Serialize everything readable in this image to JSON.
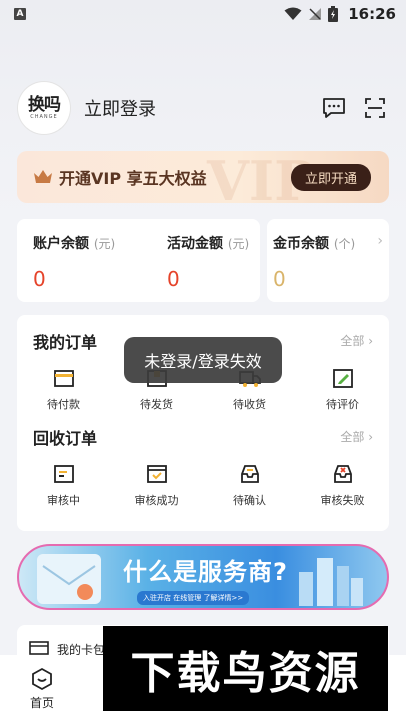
{
  "status_bar": {
    "time": "16:26",
    "notification_letter": "A"
  },
  "header": {
    "logo_text": "换吗",
    "logo_subtext": "CHANGE",
    "login_label": "立即登录"
  },
  "vip_banner": {
    "text": "开通VIP 享五大权益",
    "button_label": "立即开通"
  },
  "balance": {
    "account": {
      "label": "账户余额",
      "unit": "(元)",
      "value": "0"
    },
    "activity": {
      "label": "活动金额",
      "unit": "(元)",
      "value": "0"
    },
    "gold": {
      "label": "金币余额",
      "unit": "(个)",
      "value": "0"
    }
  },
  "my_orders": {
    "title": "我的订单",
    "all_label": "全部 ›",
    "items": [
      {
        "label": "待付款",
        "icon": "wallet-icon"
      },
      {
        "label": "待发货",
        "icon": "box-icon"
      },
      {
        "label": "待收货",
        "icon": "truck-icon"
      },
      {
        "label": "待评价",
        "icon": "edit-icon"
      }
    ]
  },
  "recycle_orders": {
    "title": "回收订单",
    "all_label": "全部 ›",
    "items": [
      {
        "label": "审核中",
        "icon": "review-icon"
      },
      {
        "label": "审核成功",
        "icon": "approved-icon"
      },
      {
        "label": "待确认",
        "icon": "inbox-icon"
      },
      {
        "label": "审核失败",
        "icon": "rejected-icon"
      }
    ]
  },
  "toast": {
    "text": "未登录/登录失效"
  },
  "promo_banner": {
    "title": "什么是服务商?",
    "subtitle": "入驻开店 在线管理 了解详情>>"
  },
  "bottom_card": {
    "label": "我的卡包"
  },
  "nav": {
    "home_label": "首页"
  },
  "watermark": {
    "text": "下载鸟资源"
  },
  "colors": {
    "accent_red": "#e5432a",
    "gold": "#d9b46a",
    "vip_dark": "#3a2018"
  }
}
